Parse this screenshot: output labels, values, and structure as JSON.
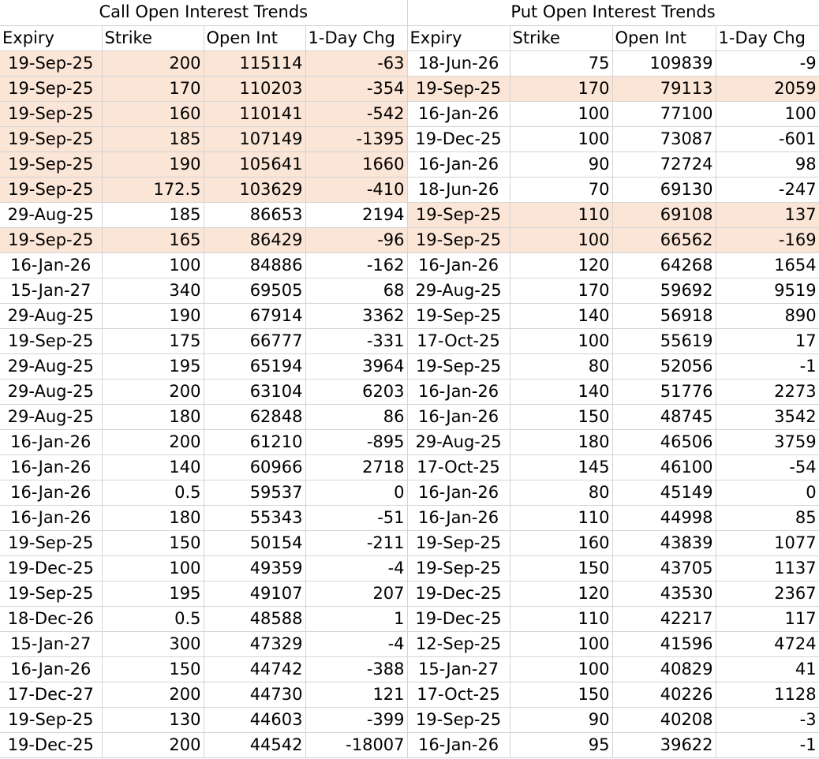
{
  "call_table": {
    "title": "Call Open Interest Trends",
    "columns": [
      "Expiry",
      "Strike",
      "Open Int",
      "1-Day Chg"
    ],
    "highlight_color": "#fbe5d6",
    "rows": [
      {
        "expiry": "19-Sep-25",
        "strike": "200",
        "open_int": "115114",
        "chg": "-63",
        "highlighted": true
      },
      {
        "expiry": "19-Sep-25",
        "strike": "170",
        "open_int": "110203",
        "chg": "-354",
        "highlighted": true
      },
      {
        "expiry": "19-Sep-25",
        "strike": "160",
        "open_int": "110141",
        "chg": "-542",
        "highlighted": true
      },
      {
        "expiry": "19-Sep-25",
        "strike": "185",
        "open_int": "107149",
        "chg": "-1395",
        "highlighted": true
      },
      {
        "expiry": "19-Sep-25",
        "strike": "190",
        "open_int": "105641",
        "chg": "1660",
        "highlighted": true
      },
      {
        "expiry": "19-Sep-25",
        "strike": "172.5",
        "open_int": "103629",
        "chg": "-410",
        "highlighted": true
      },
      {
        "expiry": "29-Aug-25",
        "strike": "185",
        "open_int": "86653",
        "chg": "2194",
        "highlighted": false
      },
      {
        "expiry": "19-Sep-25",
        "strike": "165",
        "open_int": "86429",
        "chg": "-96",
        "highlighted": true
      },
      {
        "expiry": "16-Jan-26",
        "strike": "100",
        "open_int": "84886",
        "chg": "-162",
        "highlighted": false
      },
      {
        "expiry": "15-Jan-27",
        "strike": "340",
        "open_int": "69505",
        "chg": "68",
        "highlighted": false
      },
      {
        "expiry": "29-Aug-25",
        "strike": "190",
        "open_int": "67914",
        "chg": "3362",
        "highlighted": false
      },
      {
        "expiry": "19-Sep-25",
        "strike": "175",
        "open_int": "66777",
        "chg": "-331",
        "highlighted": false
      },
      {
        "expiry": "29-Aug-25",
        "strike": "195",
        "open_int": "65194",
        "chg": "3964",
        "highlighted": false
      },
      {
        "expiry": "29-Aug-25",
        "strike": "200",
        "open_int": "63104",
        "chg": "6203",
        "highlighted": false
      },
      {
        "expiry": "29-Aug-25",
        "strike": "180",
        "open_int": "62848",
        "chg": "86",
        "highlighted": false
      },
      {
        "expiry": "16-Jan-26",
        "strike": "200",
        "open_int": "61210",
        "chg": "-895",
        "highlighted": false
      },
      {
        "expiry": "16-Jan-26",
        "strike": "140",
        "open_int": "60966",
        "chg": "2718",
        "highlighted": false
      },
      {
        "expiry": "16-Jan-26",
        "strike": "0.5",
        "open_int": "59537",
        "chg": "0",
        "highlighted": false
      },
      {
        "expiry": "16-Jan-26",
        "strike": "180",
        "open_int": "55343",
        "chg": "-51",
        "highlighted": false
      },
      {
        "expiry": "19-Sep-25",
        "strike": "150",
        "open_int": "50154",
        "chg": "-211",
        "highlighted": false
      },
      {
        "expiry": "19-Dec-25",
        "strike": "100",
        "open_int": "49359",
        "chg": "-4",
        "highlighted": false
      },
      {
        "expiry": "19-Sep-25",
        "strike": "195",
        "open_int": "49107",
        "chg": "207",
        "highlighted": false
      },
      {
        "expiry": "18-Dec-26",
        "strike": "0.5",
        "open_int": "48588",
        "chg": "1",
        "highlighted": false
      },
      {
        "expiry": "15-Jan-27",
        "strike": "300",
        "open_int": "47329",
        "chg": "-4",
        "highlighted": false
      },
      {
        "expiry": "16-Jan-26",
        "strike": "150",
        "open_int": "44742",
        "chg": "-388",
        "highlighted": false
      },
      {
        "expiry": "17-Dec-27",
        "strike": "200",
        "open_int": "44730",
        "chg": "121",
        "highlighted": false
      },
      {
        "expiry": "19-Sep-25",
        "strike": "130",
        "open_int": "44603",
        "chg": "-399",
        "highlighted": false
      },
      {
        "expiry": "19-Dec-25",
        "strike": "200",
        "open_int": "44542",
        "chg": "-18007",
        "highlighted": false
      }
    ]
  },
  "put_table": {
    "title": "Put Open Interest Trends",
    "columns": [
      "Expiry",
      "Strike",
      "Open Int",
      "1-Day Chg"
    ],
    "highlight_color": "#fbe5d6",
    "rows": [
      {
        "expiry": "18-Jun-26",
        "strike": "75",
        "open_int": "109839",
        "chg": "-9",
        "highlighted": false
      },
      {
        "expiry": "19-Sep-25",
        "strike": "170",
        "open_int": "79113",
        "chg": "2059",
        "highlighted": true
      },
      {
        "expiry": "16-Jan-26",
        "strike": "100",
        "open_int": "77100",
        "chg": "100",
        "highlighted": false
      },
      {
        "expiry": "19-Dec-25",
        "strike": "100",
        "open_int": "73087",
        "chg": "-601",
        "highlighted": false
      },
      {
        "expiry": "16-Jan-26",
        "strike": "90",
        "open_int": "72724",
        "chg": "98",
        "highlighted": false
      },
      {
        "expiry": "18-Jun-26",
        "strike": "70",
        "open_int": "69130",
        "chg": "-247",
        "highlighted": false
      },
      {
        "expiry": "19-Sep-25",
        "strike": "110",
        "open_int": "69108",
        "chg": "137",
        "highlighted": true
      },
      {
        "expiry": "19-Sep-25",
        "strike": "100",
        "open_int": "66562",
        "chg": "-169",
        "highlighted": true
      },
      {
        "expiry": "16-Jan-26",
        "strike": "120",
        "open_int": "64268",
        "chg": "1654",
        "highlighted": false
      },
      {
        "expiry": "29-Aug-25",
        "strike": "170",
        "open_int": "59692",
        "chg": "9519",
        "highlighted": false
      },
      {
        "expiry": "19-Sep-25",
        "strike": "140",
        "open_int": "56918",
        "chg": "890",
        "highlighted": false
      },
      {
        "expiry": "17-Oct-25",
        "strike": "100",
        "open_int": "55619",
        "chg": "17",
        "highlighted": false
      },
      {
        "expiry": "19-Sep-25",
        "strike": "80",
        "open_int": "52056",
        "chg": "-1",
        "highlighted": false
      },
      {
        "expiry": "16-Jan-26",
        "strike": "140",
        "open_int": "51776",
        "chg": "2273",
        "highlighted": false
      },
      {
        "expiry": "16-Jan-26",
        "strike": "150",
        "open_int": "48745",
        "chg": "3542",
        "highlighted": false
      },
      {
        "expiry": "29-Aug-25",
        "strike": "180",
        "open_int": "46506",
        "chg": "3759",
        "highlighted": false
      },
      {
        "expiry": "17-Oct-25",
        "strike": "145",
        "open_int": "46100",
        "chg": "-54",
        "highlighted": false
      },
      {
        "expiry": "16-Jan-26",
        "strike": "80",
        "open_int": "45149",
        "chg": "0",
        "highlighted": false
      },
      {
        "expiry": "16-Jan-26",
        "strike": "110",
        "open_int": "44998",
        "chg": "85",
        "highlighted": false
      },
      {
        "expiry": "19-Sep-25",
        "strike": "160",
        "open_int": "43839",
        "chg": "1077",
        "highlighted": false
      },
      {
        "expiry": "19-Sep-25",
        "strike": "150",
        "open_int": "43705",
        "chg": "1137",
        "highlighted": false
      },
      {
        "expiry": "19-Dec-25",
        "strike": "120",
        "open_int": "43530",
        "chg": "2367",
        "highlighted": false
      },
      {
        "expiry": "19-Dec-25",
        "strike": "110",
        "open_int": "42217",
        "chg": "117",
        "highlighted": false
      },
      {
        "expiry": "12-Sep-25",
        "strike": "100",
        "open_int": "41596",
        "chg": "4724",
        "highlighted": false
      },
      {
        "expiry": "15-Jan-27",
        "strike": "100",
        "open_int": "40829",
        "chg": "41",
        "highlighted": false
      },
      {
        "expiry": "17-Oct-25",
        "strike": "150",
        "open_int": "40226",
        "chg": "1128",
        "highlighted": false
      },
      {
        "expiry": "19-Sep-25",
        "strike": "90",
        "open_int": "40208",
        "chg": "-3",
        "highlighted": false
      },
      {
        "expiry": "16-Jan-26",
        "strike": "95",
        "open_int": "39622",
        "chg": "-1",
        "highlighted": false
      }
    ]
  }
}
